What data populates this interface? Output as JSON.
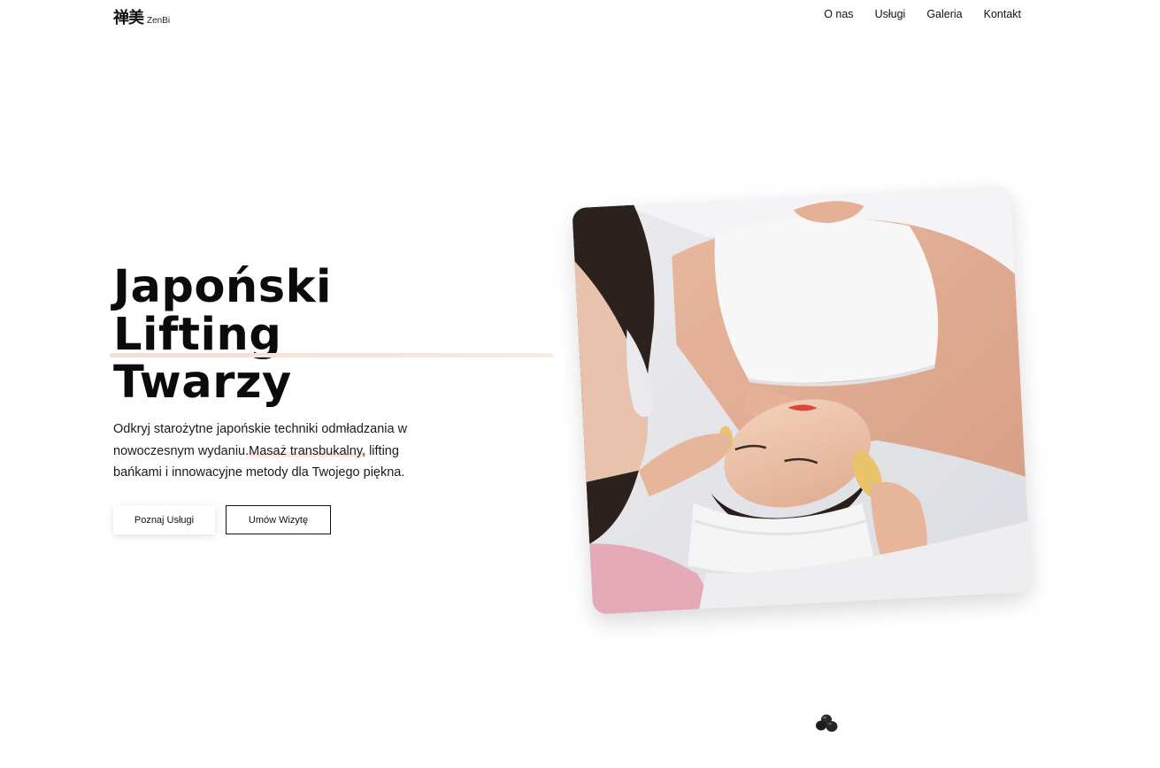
{
  "header": {
    "logo_kanji": "禅美",
    "logo_sub": "ZenBi",
    "nav": [
      {
        "label": "O nas"
      },
      {
        "label": "Usługi"
      },
      {
        "label": "Galeria"
      },
      {
        "label": "Kontakt"
      }
    ]
  },
  "hero": {
    "title_lines": [
      "Japoński",
      "Lifting",
      "Twarzy"
    ],
    "description_before": "Odkryj starożytne japońskie techniki odmładzania w nowoczesnym wydaniu.",
    "description_highlight": "Masaż transbukalny,",
    "description_after": " lifting bańkami i innowacyjne metody dla Twojego piękna.",
    "primary_button": "Poznaj Usługi",
    "secondary_button": "Umów Wizytę"
  },
  "colors": {
    "accent_underline": "#f6ddd2",
    "text": "#111111",
    "background": "#ffffff"
  }
}
